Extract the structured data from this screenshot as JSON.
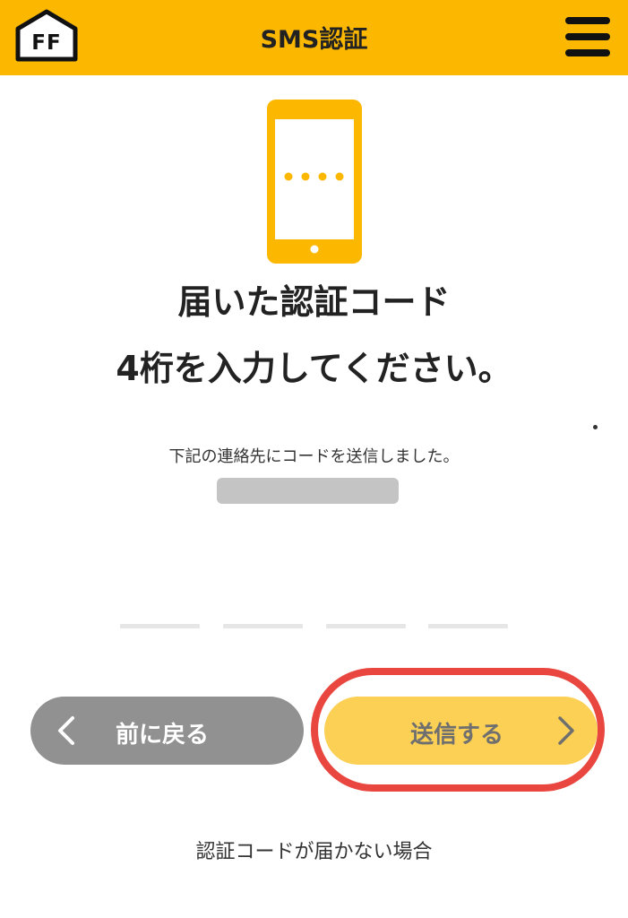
{
  "header": {
    "logo_text": "FF",
    "title": "SMS認証"
  },
  "main": {
    "heading_line1": "届いた認証コード",
    "heading_line2": "4桁を入力してください。",
    "sent_note": "下記の連絡先にコードを送信しました。",
    "code_length": 4
  },
  "actions": {
    "back_label": "前に戻る",
    "send_label": "送信する"
  },
  "links": {
    "not_received": "認証コードが届かない場合"
  },
  "colors": {
    "header_bg": "#fcb800",
    "phone_accent": "#fcb800",
    "send_button_bg": "#fcd055",
    "back_button_bg": "#919191",
    "highlight_ring": "#e8463f"
  },
  "icons": {
    "logo": "house-logo-icon",
    "menu": "hamburger-menu-icon",
    "illustration": "smartphone-icon",
    "back": "chevron-left-icon",
    "forward": "chevron-right-icon"
  }
}
